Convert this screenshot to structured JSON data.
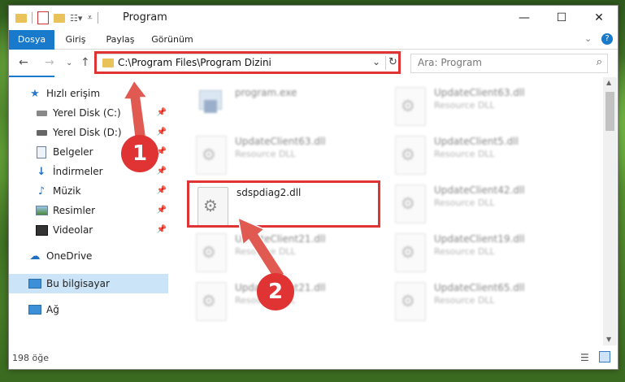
{
  "window": {
    "title": "Program",
    "controls": {
      "minimize": "—",
      "maximize": "☐",
      "close": "✕"
    }
  },
  "ribbon": {
    "tabs": [
      {
        "label": "Dosya"
      },
      {
        "label": "Giriş"
      },
      {
        "label": "Paylaş"
      },
      {
        "label": "Görünüm"
      }
    ]
  },
  "nav": {
    "address": "C:\\Program Files\\Program Dizini",
    "search_placeholder": "Ara: Program"
  },
  "sidebar": {
    "items": [
      {
        "label": "Hızlı erişim",
        "icon": "star-icon"
      },
      {
        "label": "Yerel Disk (C:)",
        "icon": "drive-icon",
        "pinned": true
      },
      {
        "label": "Yerel Disk (D:)",
        "icon": "drive-icon",
        "pinned": true
      },
      {
        "label": "Belgeler",
        "icon": "documents-icon",
        "pinned": true
      },
      {
        "label": "İndirmeler",
        "icon": "download-icon",
        "pinned": true
      },
      {
        "label": "Müzik",
        "icon": "music-icon",
        "pinned": true
      },
      {
        "label": "Resimler",
        "icon": "pictures-icon",
        "pinned": true
      },
      {
        "label": "Videolar",
        "icon": "videos-icon",
        "pinned": true
      },
      {
        "label": "OneDrive",
        "icon": "cloud-icon"
      },
      {
        "label": "Bu bilgisayar",
        "icon": "computer-icon",
        "selected": true
      },
      {
        "label": "Ağ",
        "icon": "network-icon"
      }
    ]
  },
  "files": {
    "exe": {
      "name": "program.exe"
    },
    "highlighted": {
      "name": "sdspdiag2.dll"
    },
    "items": [
      {
        "name": "UpdateClient63.dll",
        "desc": "Resource DLL"
      },
      {
        "name": "UpdateClient63.dll",
        "desc": "Resource DLL"
      },
      {
        "name": "UpdateClient5.dll",
        "desc": "Resource DLL"
      },
      {
        "name": "UpdateClient42.dll",
        "desc": "Resource DLL"
      },
      {
        "name": "UpdateClient21.dll",
        "desc": "Resource DLL"
      },
      {
        "name": "UpdateClient19.dll",
        "desc": "Resource DLL"
      },
      {
        "name": "UpdateClient21.dll",
        "desc": "Resource DLL"
      },
      {
        "name": "UpdateClient65.dll",
        "desc": "Resource DLL"
      }
    ]
  },
  "status": {
    "count": "198 öğe"
  },
  "annotations": {
    "step1": "1",
    "step2": "2",
    "color": "#e03434"
  }
}
